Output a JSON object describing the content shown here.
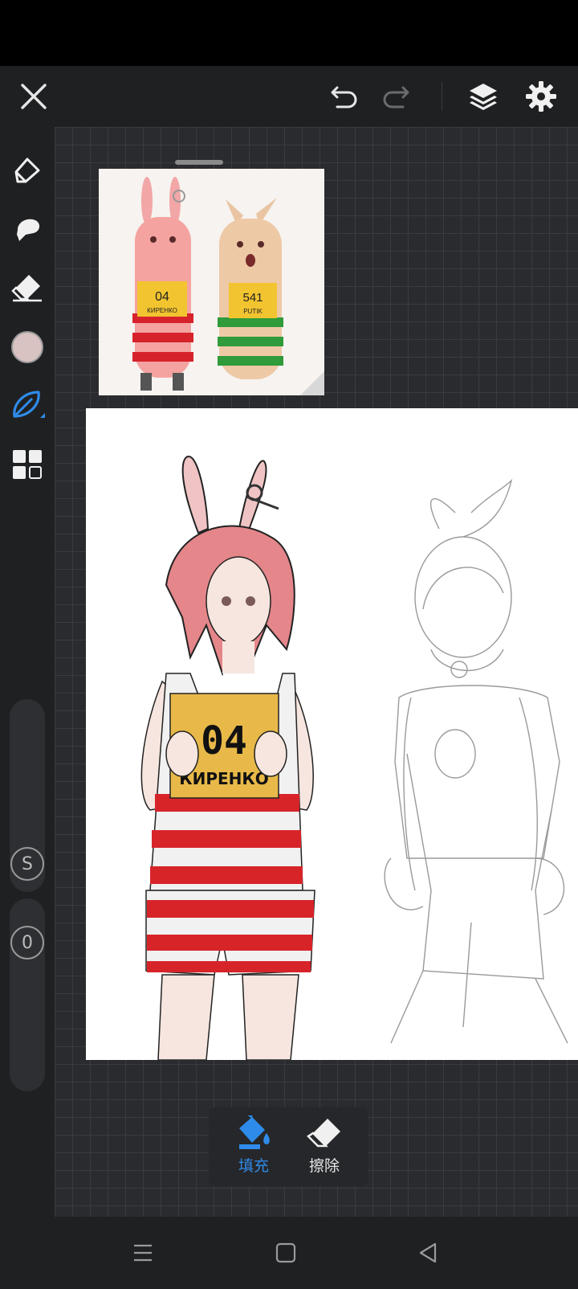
{
  "toolbar": {
    "close": "close",
    "undo": "undo",
    "redo": "redo",
    "layers": "layers",
    "settings": "settings"
  },
  "sidebar": {
    "tools": [
      "pen-icon",
      "smudge-icon",
      "eraser-icon",
      "color-swatch",
      "brush-icon",
      "grid-icon"
    ],
    "current_color": "#d8c3c2",
    "size_label": "S",
    "opacity_label": "0"
  },
  "reference": {
    "left_sign_number": "04",
    "left_sign_name": "КИРЕНКО",
    "right_sign_number": "541",
    "right_sign_name": "PUTIK"
  },
  "canvas": {
    "sign_number": "04",
    "sign_name": "КИРЕНКО"
  },
  "fill_panel": {
    "fill_label": "填充",
    "erase_label": "擦除",
    "active": "fill"
  },
  "colors": {
    "accent": "#2f8be9",
    "panel": "#1f2022"
  }
}
